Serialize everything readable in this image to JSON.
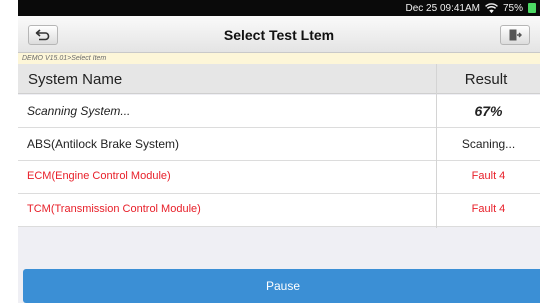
{
  "status_bar": {
    "time": "Dec 25 09:41AM",
    "battery": "75%",
    "colors": {
      "battery": "#4cd964"
    }
  },
  "header": {
    "title": "Select Test Ltem",
    "back_icon": "back-arrow-icon",
    "exit_icon": "exit-door-icon"
  },
  "breadcrumb": "DEMO V15.01>Select Item",
  "table": {
    "columns": [
      "System Name",
      "Result"
    ],
    "rows": [
      {
        "name": "Scanning System...",
        "result": "67%",
        "state": "progress"
      },
      {
        "name": "ABS(Antilock Brake System)",
        "result": "Scaning...",
        "state": "scanning"
      },
      {
        "name": "ECM(Engine Control Module)",
        "result": "Fault 4",
        "state": "fault"
      },
      {
        "name": "TCM(Transmission Control Module)",
        "result": "Fault 4",
        "state": "fault"
      }
    ]
  },
  "footer": {
    "pause_label": "Pause"
  },
  "colors": {
    "accent": "#3b8fd5",
    "fault": "#e8202a",
    "header_bg": "#e6e6e6"
  }
}
